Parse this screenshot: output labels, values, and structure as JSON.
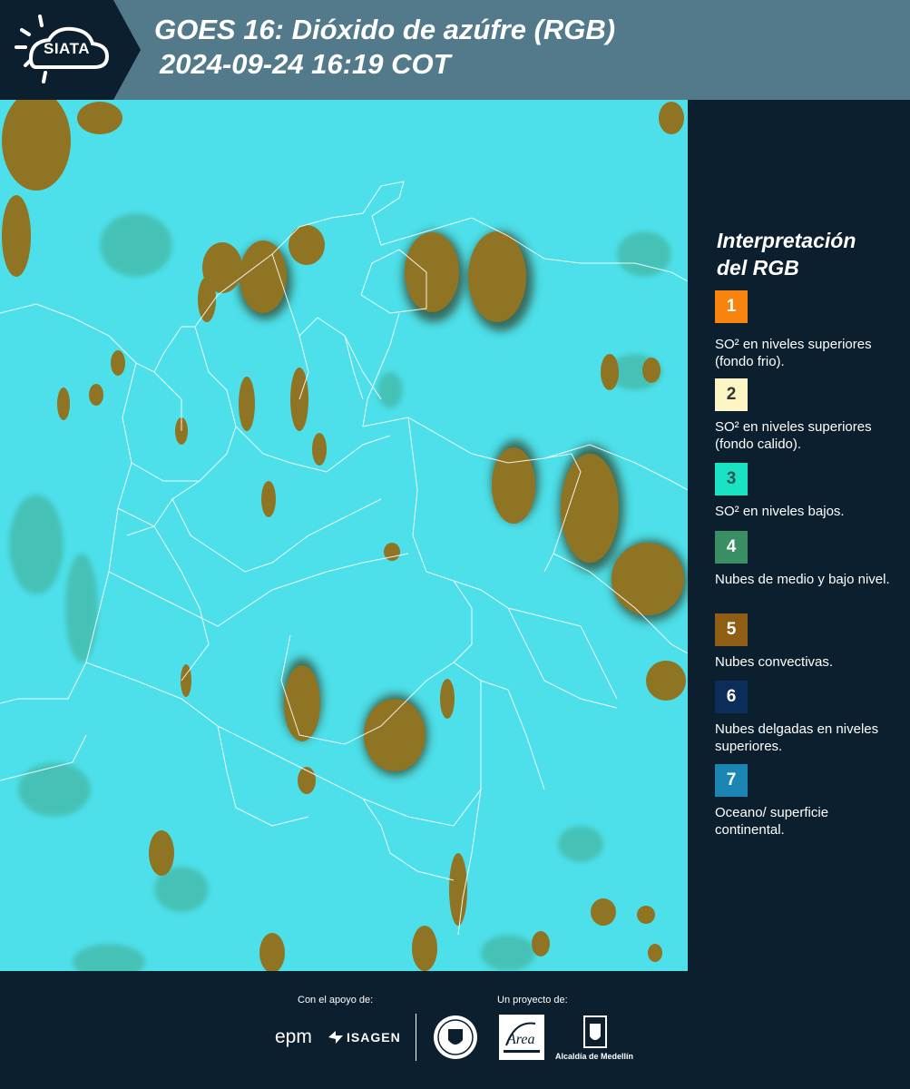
{
  "header": {
    "logo_text": "SIATA",
    "title_line1": "GOES 16: Dióxido de azúfre (RGB)",
    "title_line2": "2024-09-24 16:19 COT",
    "background_color": "#537a8b"
  },
  "map": {
    "base_color": "#4de0ea",
    "convective_color": "#8f7424",
    "border_color": "#ffffff"
  },
  "legend": {
    "title_line1": "Interpretación",
    "title_line2": "del RGB",
    "items": [
      {
        "number": "1",
        "color": "#f7840f",
        "text_color": "#ffffff",
        "label": "SO² en niveles superiores (fondo frio)."
      },
      {
        "number": "2",
        "color": "#fdf6c4",
        "text_color": "#333333",
        "label": "SO² en niveles superiores (fondo calido)."
      },
      {
        "number": "3",
        "color": "#19e3c3",
        "text_color": "#225555",
        "label": "SO² en niveles bajos."
      },
      {
        "number": "4",
        "color": "#3a8e63",
        "text_color": "#ffffff",
        "label": "Nubes de medio y bajo nivel."
      },
      {
        "number": "5",
        "color": "#8f5d14",
        "text_color": "#ffffff",
        "label": "Nubes convectivas."
      },
      {
        "number": "6",
        "color": "#0a2d5a",
        "text_color": "#ffffff",
        "label": "Nubes delgadas en niveles superiores."
      },
      {
        "number": "7",
        "color": "#1b86b4",
        "text_color": "#ffffff",
        "label": "Oceano/ superficie continental."
      }
    ]
  },
  "footer": {
    "support_label": "Con el apoyo de:",
    "project_label": "Un proyecto de:",
    "sponsor1": "epm",
    "sponsor2": "ISAGEN",
    "partner1": "Área",
    "partner2": "Alcaldía de Medellín"
  }
}
